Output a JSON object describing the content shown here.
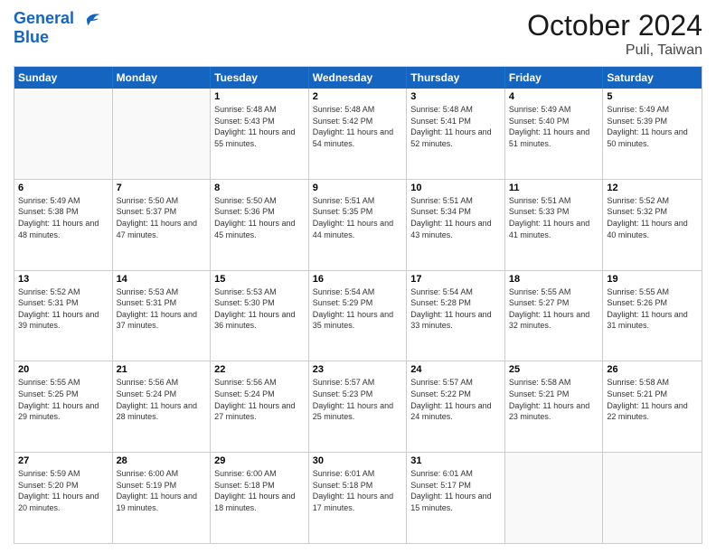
{
  "header": {
    "logo_line1": "General",
    "logo_line2": "Blue",
    "month": "October 2024",
    "location": "Puli, Taiwan"
  },
  "days_of_week": [
    "Sunday",
    "Monday",
    "Tuesday",
    "Wednesday",
    "Thursday",
    "Friday",
    "Saturday"
  ],
  "weeks": [
    [
      {
        "day": "",
        "empty": true
      },
      {
        "day": "",
        "empty": true
      },
      {
        "day": "1",
        "sunrise": "Sunrise: 5:48 AM",
        "sunset": "Sunset: 5:43 PM",
        "daylight": "Daylight: 11 hours and 55 minutes."
      },
      {
        "day": "2",
        "sunrise": "Sunrise: 5:48 AM",
        "sunset": "Sunset: 5:42 PM",
        "daylight": "Daylight: 11 hours and 54 minutes."
      },
      {
        "day": "3",
        "sunrise": "Sunrise: 5:48 AM",
        "sunset": "Sunset: 5:41 PM",
        "daylight": "Daylight: 11 hours and 52 minutes."
      },
      {
        "day": "4",
        "sunrise": "Sunrise: 5:49 AM",
        "sunset": "Sunset: 5:40 PM",
        "daylight": "Daylight: 11 hours and 51 minutes."
      },
      {
        "day": "5",
        "sunrise": "Sunrise: 5:49 AM",
        "sunset": "Sunset: 5:39 PM",
        "daylight": "Daylight: 11 hours and 50 minutes."
      }
    ],
    [
      {
        "day": "6",
        "sunrise": "Sunrise: 5:49 AM",
        "sunset": "Sunset: 5:38 PM",
        "daylight": "Daylight: 11 hours and 48 minutes."
      },
      {
        "day": "7",
        "sunrise": "Sunrise: 5:50 AM",
        "sunset": "Sunset: 5:37 PM",
        "daylight": "Daylight: 11 hours and 47 minutes."
      },
      {
        "day": "8",
        "sunrise": "Sunrise: 5:50 AM",
        "sunset": "Sunset: 5:36 PM",
        "daylight": "Daylight: 11 hours and 45 minutes."
      },
      {
        "day": "9",
        "sunrise": "Sunrise: 5:51 AM",
        "sunset": "Sunset: 5:35 PM",
        "daylight": "Daylight: 11 hours and 44 minutes."
      },
      {
        "day": "10",
        "sunrise": "Sunrise: 5:51 AM",
        "sunset": "Sunset: 5:34 PM",
        "daylight": "Daylight: 11 hours and 43 minutes."
      },
      {
        "day": "11",
        "sunrise": "Sunrise: 5:51 AM",
        "sunset": "Sunset: 5:33 PM",
        "daylight": "Daylight: 11 hours and 41 minutes."
      },
      {
        "day": "12",
        "sunrise": "Sunrise: 5:52 AM",
        "sunset": "Sunset: 5:32 PM",
        "daylight": "Daylight: 11 hours and 40 minutes."
      }
    ],
    [
      {
        "day": "13",
        "sunrise": "Sunrise: 5:52 AM",
        "sunset": "Sunset: 5:31 PM",
        "daylight": "Daylight: 11 hours and 39 minutes."
      },
      {
        "day": "14",
        "sunrise": "Sunrise: 5:53 AM",
        "sunset": "Sunset: 5:31 PM",
        "daylight": "Daylight: 11 hours and 37 minutes."
      },
      {
        "day": "15",
        "sunrise": "Sunrise: 5:53 AM",
        "sunset": "Sunset: 5:30 PM",
        "daylight": "Daylight: 11 hours and 36 minutes."
      },
      {
        "day": "16",
        "sunrise": "Sunrise: 5:54 AM",
        "sunset": "Sunset: 5:29 PM",
        "daylight": "Daylight: 11 hours and 35 minutes."
      },
      {
        "day": "17",
        "sunrise": "Sunrise: 5:54 AM",
        "sunset": "Sunset: 5:28 PM",
        "daylight": "Daylight: 11 hours and 33 minutes."
      },
      {
        "day": "18",
        "sunrise": "Sunrise: 5:55 AM",
        "sunset": "Sunset: 5:27 PM",
        "daylight": "Daylight: 11 hours and 32 minutes."
      },
      {
        "day": "19",
        "sunrise": "Sunrise: 5:55 AM",
        "sunset": "Sunset: 5:26 PM",
        "daylight": "Daylight: 11 hours and 31 minutes."
      }
    ],
    [
      {
        "day": "20",
        "sunrise": "Sunrise: 5:55 AM",
        "sunset": "Sunset: 5:25 PM",
        "daylight": "Daylight: 11 hours and 29 minutes."
      },
      {
        "day": "21",
        "sunrise": "Sunrise: 5:56 AM",
        "sunset": "Sunset: 5:24 PM",
        "daylight": "Daylight: 11 hours and 28 minutes."
      },
      {
        "day": "22",
        "sunrise": "Sunrise: 5:56 AM",
        "sunset": "Sunset: 5:24 PM",
        "daylight": "Daylight: 11 hours and 27 minutes."
      },
      {
        "day": "23",
        "sunrise": "Sunrise: 5:57 AM",
        "sunset": "Sunset: 5:23 PM",
        "daylight": "Daylight: 11 hours and 25 minutes."
      },
      {
        "day": "24",
        "sunrise": "Sunrise: 5:57 AM",
        "sunset": "Sunset: 5:22 PM",
        "daylight": "Daylight: 11 hours and 24 minutes."
      },
      {
        "day": "25",
        "sunrise": "Sunrise: 5:58 AM",
        "sunset": "Sunset: 5:21 PM",
        "daylight": "Daylight: 11 hours and 23 minutes."
      },
      {
        "day": "26",
        "sunrise": "Sunrise: 5:58 AM",
        "sunset": "Sunset: 5:21 PM",
        "daylight": "Daylight: 11 hours and 22 minutes."
      }
    ],
    [
      {
        "day": "27",
        "sunrise": "Sunrise: 5:59 AM",
        "sunset": "Sunset: 5:20 PM",
        "daylight": "Daylight: 11 hours and 20 minutes."
      },
      {
        "day": "28",
        "sunrise": "Sunrise: 6:00 AM",
        "sunset": "Sunset: 5:19 PM",
        "daylight": "Daylight: 11 hours and 19 minutes."
      },
      {
        "day": "29",
        "sunrise": "Sunrise: 6:00 AM",
        "sunset": "Sunset: 5:18 PM",
        "daylight": "Daylight: 11 hours and 18 minutes."
      },
      {
        "day": "30",
        "sunrise": "Sunrise: 6:01 AM",
        "sunset": "Sunset: 5:18 PM",
        "daylight": "Daylight: 11 hours and 17 minutes."
      },
      {
        "day": "31",
        "sunrise": "Sunrise: 6:01 AM",
        "sunset": "Sunset: 5:17 PM",
        "daylight": "Daylight: 11 hours and 15 minutes."
      },
      {
        "day": "",
        "empty": true
      },
      {
        "day": "",
        "empty": true
      }
    ]
  ]
}
